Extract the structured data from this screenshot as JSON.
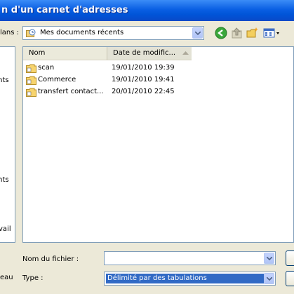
{
  "window": {
    "title": "n d'un carnet d'adresses"
  },
  "toolbar": {
    "lookin_label": "lans :",
    "lookin_value": "Mes documents récents",
    "icons": [
      "back-icon",
      "up-folder-icon",
      "new-folder-icon",
      "views-menu-icon"
    ]
  },
  "places": [
    {
      "label": "ents"
    },
    {
      "label": "ents"
    },
    {
      "label": "vail"
    },
    {
      "label": "eau"
    }
  ],
  "filelist": {
    "columns": [
      "Nom",
      "Date de modific..."
    ],
    "rows": [
      {
        "name": "scan",
        "date": "19/01/2010 19:39"
      },
      {
        "name": "Commerce",
        "date": "19/01/2010 19:41"
      },
      {
        "name": "transfert contact...",
        "date": "20/01/2010 22:45"
      }
    ]
  },
  "bottom": {
    "filename_label": "Nom du fichier :",
    "filename_value": "",
    "type_label": "Type :",
    "type_value": "Délimité par des tabulations"
  }
}
